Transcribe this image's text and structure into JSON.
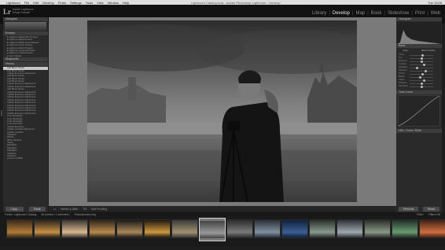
{
  "menubar": {
    "items": [
      "Lightroom",
      "File",
      "Edit",
      "Develop",
      "Photo",
      "Settings",
      "Tools",
      "View",
      "Window",
      "Help"
    ],
    "window_title": "Lightroom Catalog.lrcat - Adobe Photoshop Lightroom - Develop",
    "clock": "Tue 13:05"
  },
  "identity": {
    "logo": "Lr",
    "line1": "Adobe Lightroom",
    "line2": "Serge Ramelli"
  },
  "modules": [
    "Library",
    "Develop",
    "Map",
    "Book",
    "Slideshow",
    "Print",
    "Web"
  ],
  "active_module": "Develop",
  "left_panel": {
    "navigator_label": "Navigator",
    "presets_label": "Presets",
    "snapshots_label": "Snapshots",
    "history_label": "History",
    "collections_label": "Collections",
    "presets": [
      "Lightroom B&W Filter Presets",
      "Lightroom B&W Presets",
      "Lightroom B&W Toned Presets",
      "Lightroom Color Presets",
      "Lightroom Effect Presets",
      "Lightroom General Presets",
      "Lightroom Video Presets",
      "User Presets"
    ],
    "history": [
      "Add Brush Stroke",
      "Add Brush Stroke",
      "Update Exposure Adjustment",
      "Add Brush Stroke",
      "Add Brush Stroke",
      "Add Brush Stroke",
      "Update Exposure Adjustment",
      "Update Exposure Adjustment",
      "Add Brush Stroke",
      "Update Exposure Adjustment",
      "Update Exposure Adjustment",
      "Update Exposure Adjustment",
      "Update Exposure Adjustment",
      "Update Exposure Adjustment",
      "Update Exposure Adjustment",
      "Update Exposure Adjustment",
      "Update Exposure Adjustment",
      "Update Exposure Adjustment",
      "Crop Rectangle",
      "Crop Rectangle",
      "Crop Rectangle",
      "Lens Correction",
      "Update Exposure",
      "Update Contrast Adjustment",
      "Update Contrast",
      "Shadows",
      "Whites",
      "White Clipping",
      "Clarity",
      "Highlights",
      "Highlights",
      "Highlights",
      "Shadows",
      "Shadows",
      "Convert to B&W"
    ],
    "copy_label": "Copy...",
    "paste_label": "Paste"
  },
  "toolbar": {
    "soft_proofing": "Soft Proofing",
    "view_label": "Before & After:",
    "zoom": "Fit"
  },
  "right_panel": {
    "histogram_label": "Histogram",
    "basic_label": "Basic",
    "tone_curve_label": "Tone Curve",
    "hsl_label": "HSL / Color / B&W",
    "treatment": [
      "Color",
      "Black & White"
    ],
    "sliders": [
      {
        "label": "Temp",
        "value": 0.55
      },
      {
        "label": "Tint",
        "value": 0.5
      },
      {
        "label": "Exposure",
        "value": 0.52
      },
      {
        "label": "Contrast",
        "value": 0.62
      },
      {
        "label": "Highlights",
        "value": 0.3
      },
      {
        "label": "Shadows",
        "value": 0.7
      },
      {
        "label": "Whites",
        "value": 0.55
      },
      {
        "label": "Blacks",
        "value": 0.45
      },
      {
        "label": "Clarity",
        "value": 0.6
      },
      {
        "label": "Vibrance",
        "value": 0.5
      },
      {
        "label": "Saturation",
        "value": 0.5
      }
    ],
    "previous_label": "Previous",
    "reset_label": "Reset"
  },
  "filmstrip": {
    "source": "Folder: Lightroom Catalog",
    "count": "84 photos / 1 selected / ",
    "filename": "ParisJanuary.dng",
    "filter_label": "Filter:",
    "filter_value": "Filters Off"
  },
  "colors": {
    "panel": "#2a2a2a",
    "background": "#7a7a7a",
    "text": "#c8c8c8",
    "active": "#e6e6e6"
  }
}
